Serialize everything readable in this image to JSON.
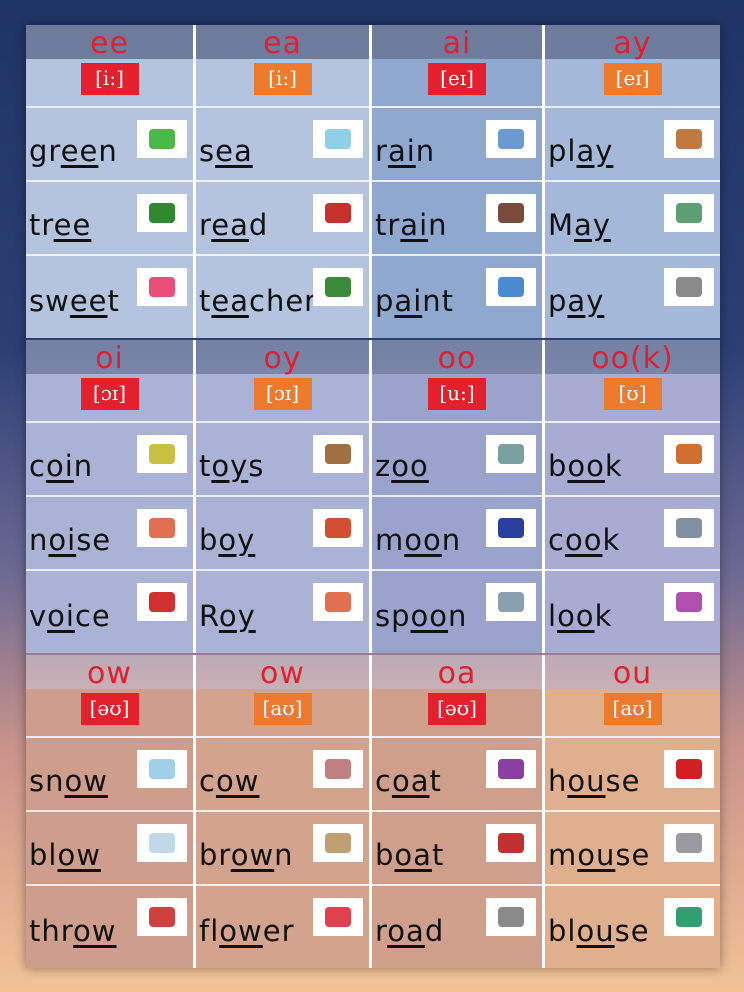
{
  "colors": {
    "ipa_red": "#e4202c",
    "ipa_orange": "#ee7a2e",
    "letters": "#e02030"
  },
  "sections": [
    {
      "bg": [
        "#b4c3de",
        "#b4c3de",
        "#8fa8d0",
        "#a4b8da"
      ],
      "groups": [
        {
          "letters": "ee",
          "ipa": "[i:]",
          "ipa_color": "red",
          "words": [
            {
              "pre": "gr",
              "u": "ee",
              "post": "n",
              "picture": "green-cube"
            },
            {
              "pre": "tr",
              "u": "ee",
              "post": "",
              "picture": "tree"
            },
            {
              "pre": "sw",
              "u": "ee",
              "post": "t",
              "picture": "sweet-candy"
            }
          ]
        },
        {
          "letters": "ea",
          "ipa": "[i:]",
          "ipa_color": "orange",
          "words": [
            {
              "pre": "s",
              "u": "ea",
              "post": "",
              "picture": "beach-sea"
            },
            {
              "pre": "r",
              "u": "ea",
              "post": "d",
              "picture": "child-reading"
            },
            {
              "pre": "t",
              "u": "ea",
              "post": "cher",
              "picture": "teacher-blackboard"
            }
          ]
        },
        {
          "letters": "ai",
          "ipa": "[eɪ]",
          "ipa_color": "red",
          "words": [
            {
              "pre": "r",
              "u": "ai",
              "post": "n",
              "picture": "rain-window"
            },
            {
              "pre": "tr",
              "u": "ai",
              "post": "n",
              "picture": "train"
            },
            {
              "pre": "p",
              "u": "ai",
              "post": "nt",
              "picture": "child-painting"
            }
          ]
        },
        {
          "letters": "ay",
          "ipa": "[eɪ]",
          "ipa_color": "orange",
          "words": [
            {
              "pre": "pl",
              "u": "ay",
              "post": "",
              "picture": "children-playing"
            },
            {
              "pre": "M",
              "u": "ay",
              "post": "",
              "picture": "calendar"
            },
            {
              "pre": "p",
              "u": "ay",
              "post": "",
              "picture": "shop-counter"
            }
          ]
        }
      ]
    },
    {
      "bg": [
        "#aab3d6",
        "#aab3d6",
        "#9aa3cc",
        "#a8acd2"
      ],
      "groups": [
        {
          "letters": "oi",
          "ipa": "[ɔɪ]",
          "ipa_color": "red",
          "words": [
            {
              "pre": "c",
              "u": "oi",
              "post": "n",
              "picture": "coin"
            },
            {
              "pre": "n",
              "u": "oi",
              "post": "se",
              "picture": "noisy-party"
            },
            {
              "pre": "v",
              "u": "oi",
              "post": "ce",
              "picture": "child-singing"
            }
          ]
        },
        {
          "letters": "oy",
          "ipa": "[ɔɪ]",
          "ipa_color": "orange",
          "words": [
            {
              "pre": "t",
              "u": "oy",
              "post": "s",
              "picture": "toys"
            },
            {
              "pre": "b",
              "u": "oy",
              "post": "",
              "picture": "boy"
            },
            {
              "pre": "R",
              "u": "oy",
              "post": "",
              "picture": "boy-speech-bubble"
            }
          ]
        },
        {
          "letters": "oo",
          "ipa": "[u:]",
          "ipa_color": "red",
          "words": [
            {
              "pre": "z",
              "u": "oo",
              "post": "",
              "picture": "zoo"
            },
            {
              "pre": "m",
              "u": "oo",
              "post": "n",
              "picture": "moon"
            },
            {
              "pre": "sp",
              "u": "oo",
              "post": "n",
              "picture": "spoon"
            }
          ]
        },
        {
          "letters": "oo(k)",
          "ipa": "[ʊ]",
          "ipa_color": "orange",
          "words": [
            {
              "pre": "b",
              "u": "oo",
              "post": "k",
              "picture": "book"
            },
            {
              "pre": "c",
              "u": "oo",
              "post": "k",
              "picture": "cook"
            },
            {
              "pre": "l",
              "u": "oo",
              "post": "k",
              "picture": "child-looking"
            }
          ]
        }
      ]
    },
    {
      "bg": [
        "#cf9d8c",
        "#d4a38e",
        "#cf9f8c",
        "#e0b08e"
      ],
      "groups": [
        {
          "letters": "ow",
          "ipa": "[əʊ]",
          "ipa_color": "red",
          "words": [
            {
              "pre": "sn",
              "u": "ow",
              "post": "",
              "picture": "snowman"
            },
            {
              "pre": "bl",
              "u": "ow",
              "post": "",
              "picture": "wind-cloud"
            },
            {
              "pre": "thr",
              "u": "ow",
              "post": "",
              "picture": "children-throwing-ball"
            }
          ]
        },
        {
          "letters": "ow",
          "ipa": "[aʊ]",
          "ipa_color": "orange",
          "words": [
            {
              "pre": "c",
              "u": "ow",
              "post": "",
              "picture": "cow"
            },
            {
              "pre": "br",
              "u": "ow",
              "post": "n",
              "picture": "brown-parcel"
            },
            {
              "pre": "fl",
              "u": "ow",
              "post": "er",
              "picture": "flower"
            }
          ]
        },
        {
          "letters": "oa",
          "ipa": "[əʊ]",
          "ipa_color": "red",
          "words": [
            {
              "pre": "c",
              "u": "oa",
              "post": "t",
              "picture": "coat"
            },
            {
              "pre": "b",
              "u": "oa",
              "post": "t",
              "picture": "boat"
            },
            {
              "pre": "r",
              "u": "oa",
              "post": "d",
              "picture": "road"
            }
          ]
        },
        {
          "letters": "ou",
          "ipa": "[aʊ]",
          "ipa_color": "orange",
          "words": [
            {
              "pre": "h",
              "u": "ou",
              "post": "se",
              "picture": "house"
            },
            {
              "pre": "m",
              "u": "ou",
              "post": "se",
              "picture": "mouse"
            },
            {
              "pre": "bl",
              "u": "ou",
              "post": "se",
              "picture": "blouse"
            }
          ]
        }
      ]
    }
  ]
}
